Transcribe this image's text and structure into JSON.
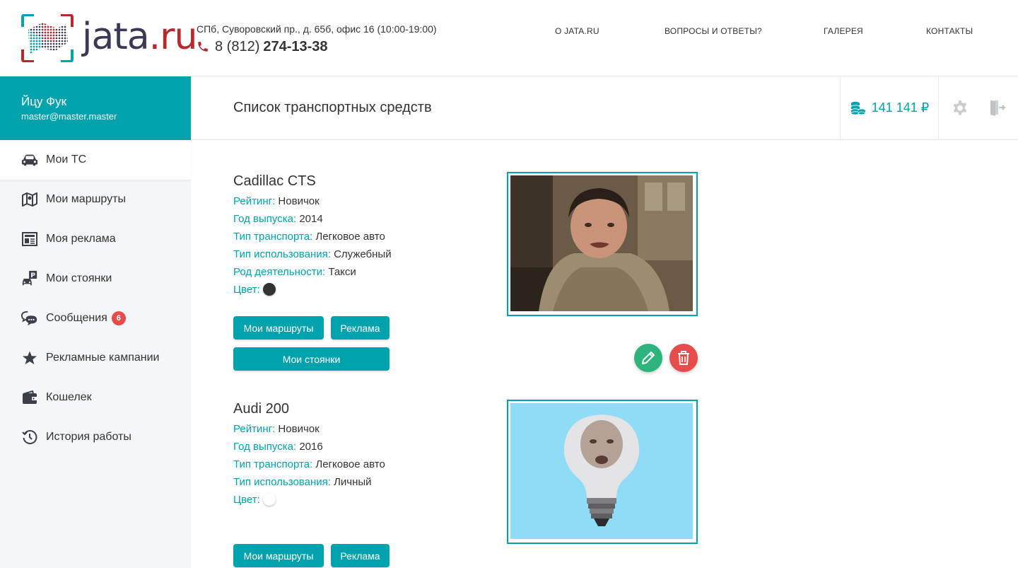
{
  "header": {
    "logo_name": "jata",
    "logo_domain": ".ru",
    "address": "СПб, Суворовский пр., д. 65б, офис 16 (10:00-19:00)",
    "phone_prefix": "8 (812)",
    "phone_number": "274-13-38",
    "nav": [
      "О JATA.RU",
      "ВОПРОСЫ И ОТВЕТЫ?",
      "ГАЛЕРЕЯ",
      "КОНТАКТЫ"
    ]
  },
  "user": {
    "name": "Йцу Фук",
    "email": "master@master.master"
  },
  "sidebar": {
    "items": [
      {
        "label": "Мои ТС",
        "icon": "car-icon",
        "active": true
      },
      {
        "label": "Мои маршруты",
        "icon": "map-icon"
      },
      {
        "label": "Моя реклама",
        "icon": "newspaper-icon"
      },
      {
        "label": "Мои стоянки",
        "icon": "parking-icon"
      },
      {
        "label": "Сообщения",
        "icon": "chat-icon",
        "badge": "6"
      },
      {
        "label": "Рекламные кампании",
        "icon": "star-icon"
      },
      {
        "label": "Кошелек",
        "icon": "wallet-icon"
      },
      {
        "label": "История работы",
        "icon": "history-icon"
      }
    ]
  },
  "titlebar": {
    "title": "Список транспортных средств",
    "balance": "141 141 ₽",
    "balance_icon": "coins-icon",
    "settings_icon": "gear-icon",
    "logout_icon": "logout-icon"
  },
  "vehicles": [
    {
      "name": "Cadillac CTS",
      "fields": [
        {
          "key": "Рейтинг:",
          "value": "Новичок"
        },
        {
          "key": "Год выпуска:",
          "value": "2014"
        },
        {
          "key": "Тип транспорта:",
          "value": "Легковое авто"
        },
        {
          "key": "Тип использования:",
          "value": "Служебный"
        },
        {
          "key": "Род деятельности:",
          "value": "Такси"
        }
      ],
      "color_label": "Цвет:",
      "color": "#333333",
      "buttons": {
        "routes": "Мои маршруты",
        "ads": "Реклама",
        "parkings": "Мои стоянки"
      }
    },
    {
      "name": "Audi 200",
      "fields": [
        {
          "key": "Рейтинг:",
          "value": "Новичок"
        },
        {
          "key": "Год выпуска:",
          "value": "2016"
        },
        {
          "key": "Тип транспорта:",
          "value": "Легковое авто"
        },
        {
          "key": "Тип использования:",
          "value": "Личный"
        }
      ],
      "color_label": "Цвет:",
      "color": "#ffffff",
      "buttons": {
        "routes": "Мои маршруты",
        "ads": "Реклама"
      }
    }
  ],
  "colors": {
    "accent": "#00a3ad",
    "danger": "#e64c4c",
    "success": "#2db37c",
    "logo_red": "#b8282d"
  }
}
